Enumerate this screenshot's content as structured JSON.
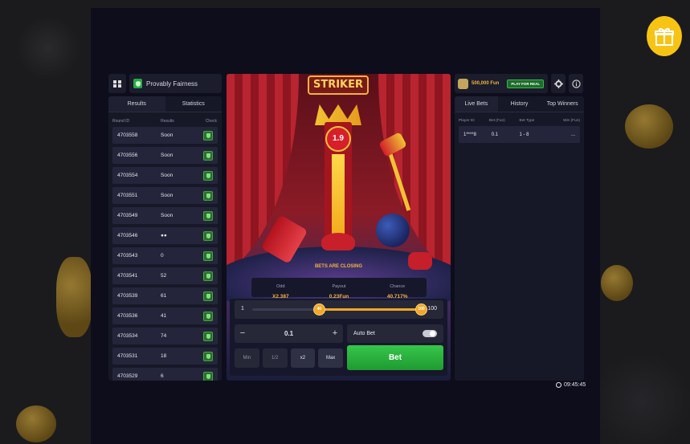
{
  "left": {
    "fairness_label": "Provably Fairness",
    "tabs": [
      {
        "label": "Results",
        "active": true
      },
      {
        "label": "Statistics",
        "active": false
      }
    ],
    "columns": {
      "round": "Round ID",
      "results": "Results",
      "check": "Check"
    },
    "rows": [
      {
        "id": "4703558",
        "result": "Soon"
      },
      {
        "id": "4703556",
        "result": "Soon"
      },
      {
        "id": "4703554",
        "result": "Soon"
      },
      {
        "id": "4703551",
        "result": "Soon"
      },
      {
        "id": "4703549",
        "result": "Soon"
      },
      {
        "id": "4703546",
        "result": "●●"
      },
      {
        "id": "4703543",
        "result": "0"
      },
      {
        "id": "4703541",
        "result": "52"
      },
      {
        "id": "4703539",
        "result": "61"
      },
      {
        "id": "4703536",
        "result": "41"
      },
      {
        "id": "4703534",
        "result": "74"
      },
      {
        "id": "4703531",
        "result": "18"
      },
      {
        "id": "4703529",
        "result": "6"
      }
    ]
  },
  "game": {
    "logo": "STRIKER",
    "multiplier": "1.9",
    "status": "BETS ARE CLOSING",
    "odd_label": "Odd",
    "odd_value": "X2.387",
    "payout_label": "Payout",
    "payout_value": "0.23Fun",
    "chance_label": "Chance",
    "chance_value": "40.717%",
    "range_min": "1",
    "range_max": "100",
    "range_low": 40,
    "range_high": 100,
    "knob_low_label": "40",
    "knob_high_label": "100",
    "amount": "0.1",
    "minus": "−",
    "plus": "+",
    "auto_bet_label": "Auto Bet",
    "quick": [
      "Min",
      "1/2",
      "x2",
      "Max"
    ],
    "bet_label": "Bet"
  },
  "right": {
    "balance": "500,000 Fun",
    "play_real": "PLAY FOR REAL",
    "tabs": [
      {
        "label": "Live Bets",
        "active": true
      },
      {
        "label": "History",
        "active": false
      },
      {
        "label": "Top Winners",
        "active": false
      }
    ],
    "columns": [
      "Player ID",
      "Bet (Fun)",
      "Bet Type",
      "Win (Fun)"
    ],
    "bets": [
      {
        "player": "1****8",
        "bet": "0.1",
        "type": "1 - 8",
        "win": "..."
      }
    ]
  },
  "clock": "09:45:45",
  "colors": {
    "accent": "#f2a726",
    "bet_green": "#2fb143",
    "panel": "#171827"
  }
}
